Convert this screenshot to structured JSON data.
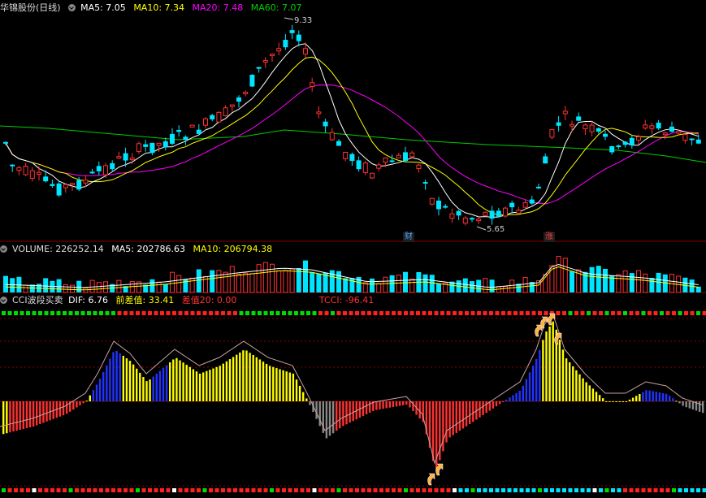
{
  "header": {
    "title": "华锦股份(日线)",
    "ma5": "MA5: 7.05",
    "ma10": "MA10: 7.34",
    "ma20": "MA20: 7.48",
    "ma60": "MA60: 7.07"
  },
  "volume_header": {
    "volume": "VOLUME: 226252.14",
    "ma5": "MA5: 202786.63",
    "ma10": "MA10: 206794.38"
  },
  "cci_header": {
    "name": "CCI波段买卖",
    "dif": "DIF: 6.76",
    "prev_diff": "前差值: 33.41",
    "diff20": "差值20: 0.00",
    "tcci": "TCCI: -96.41"
  },
  "markers": {
    "high": "9.33",
    "low": "5.65",
    "tag_cai": "财",
    "tag_zhang": "涨"
  },
  "colors": {
    "up": "#ff3232",
    "down": "#00e5ff",
    "ma5": "#ffffff",
    "ma10": "#ffff00",
    "ma20": "#ff00ff",
    "ma60": "#00cc00",
    "grid": "#8b0000",
    "cci_line": "#c8a0a0"
  },
  "icons": [
    "settings-circle-icon",
    "buy-arrow-icon"
  ]
}
